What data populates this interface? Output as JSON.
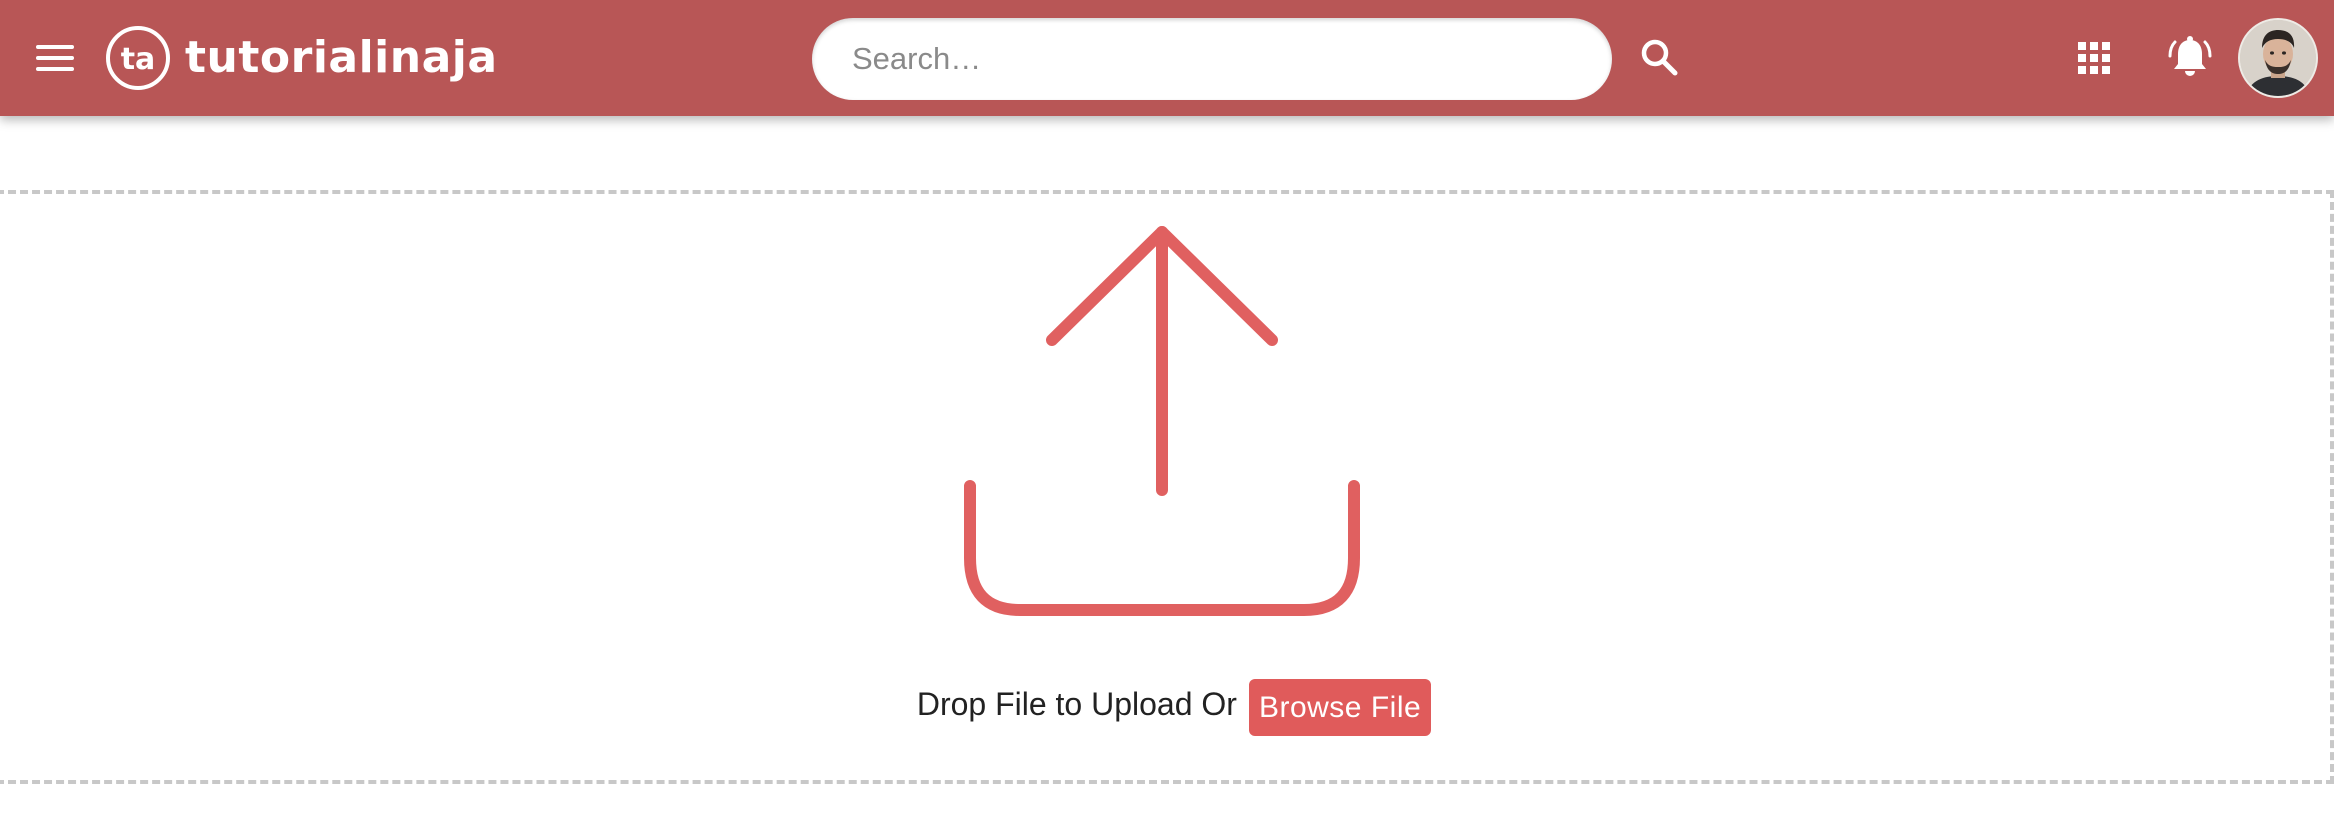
{
  "header": {
    "brand_logo_text": "ta",
    "brand_name": "tutorialinaja",
    "search": {
      "placeholder": "Search…",
      "value": ""
    },
    "icons": {
      "menu": "menu-icon",
      "search": "search-icon",
      "apps": "apps-grid-icon",
      "notifications": "bell-ringing-icon",
      "avatar": "user-avatar"
    }
  },
  "upload": {
    "icon": "upload-icon",
    "drop_text": "Drop File to Upload Or",
    "browse_label": "Browse File"
  },
  "colors": {
    "header_bg": "#b85656",
    "accent": "#e05b5b",
    "dropzone_border": "#c8c8c8"
  }
}
